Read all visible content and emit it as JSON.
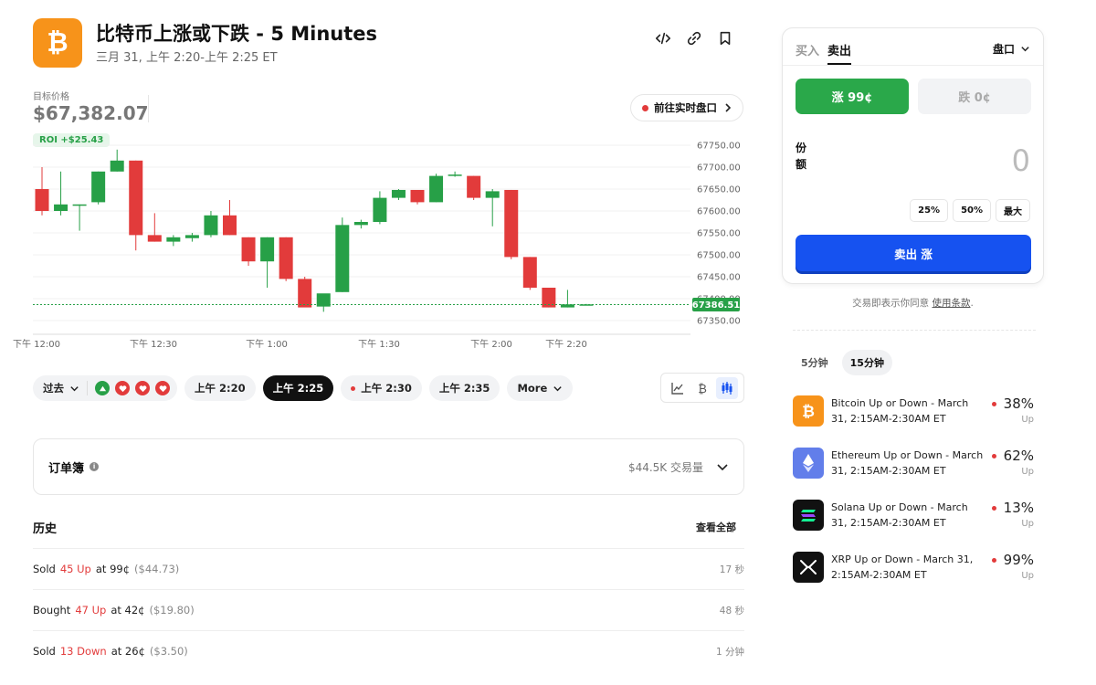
{
  "header": {
    "title": "比特币上涨或下跌 - 5 Minutes",
    "subtitle": "三月 31, 上午 2:20-上午 2:25 ET",
    "icons": [
      "embed-icon",
      "link-icon",
      "bookmark-icon"
    ]
  },
  "price": {
    "target_label": "目标价格",
    "target_value": "$67,382.07",
    "roi": "ROI +$25.43",
    "live_button": "前往实时盘口"
  },
  "chart_data": {
    "type": "candlestick",
    "y_ticks": [
      "67750.00",
      "67700.00",
      "67650.00",
      "67600.00",
      "67550.00",
      "67500.00",
      "67450.00",
      "67400.00",
      "67350.00"
    ],
    "x_ticks": [
      "下午 12:00",
      "下午 12:30",
      "下午 1:00",
      "下午 1:30",
      "下午 2:00",
      "下午 2:20"
    ],
    "ylim": [
      67350,
      67750
    ],
    "current_price": "67386.51",
    "current_price_value": 67386.51,
    "up_color": "#27a047",
    "down_color": "#e23b3b",
    "candles": [
      {
        "o": 67650,
        "h": 67700,
        "l": 67590,
        "c": 67600
      },
      {
        "o": 67600,
        "h": 67690,
        "l": 67590,
        "c": 67615
      },
      {
        "o": 67615,
        "h": 67615,
        "l": 67555,
        "c": 67615
      },
      {
        "o": 67620,
        "h": 67690,
        "l": 67615,
        "c": 67690
      },
      {
        "o": 67690,
        "h": 67740,
        "l": 67690,
        "c": 67715
      },
      {
        "o": 67715,
        "h": 67715,
        "l": 67510,
        "c": 67545
      },
      {
        "o": 67545,
        "h": 67595,
        "l": 67530,
        "c": 67530
      },
      {
        "o": 67530,
        "h": 67545,
        "l": 67520,
        "c": 67540
      },
      {
        "o": 67538,
        "h": 67550,
        "l": 67530,
        "c": 67545
      },
      {
        "o": 67545,
        "h": 67600,
        "l": 67540,
        "c": 67590
      },
      {
        "o": 67590,
        "h": 67625,
        "l": 67545,
        "c": 67545
      },
      {
        "o": 67540,
        "h": 67540,
        "l": 67475,
        "c": 67485
      },
      {
        "o": 67485,
        "h": 67540,
        "l": 67425,
        "c": 67540
      },
      {
        "o": 67540,
        "h": 67540,
        "l": 67440,
        "c": 67445
      },
      {
        "o": 67445,
        "h": 67450,
        "l": 67385,
        "c": 67380
      },
      {
        "o": 67382,
        "h": 67410,
        "l": 67370,
        "c": 67412
      },
      {
        "o": 67415,
        "h": 67585,
        "l": 67415,
        "c": 67568
      },
      {
        "o": 67568,
        "h": 67580,
        "l": 67560,
        "c": 67575
      },
      {
        "o": 67575,
        "h": 67645,
        "l": 67570,
        "c": 67630
      },
      {
        "o": 67630,
        "h": 67650,
        "l": 67625,
        "c": 67648
      },
      {
        "o": 67648,
        "h": 67648,
        "l": 67615,
        "c": 67620
      },
      {
        "o": 67620,
        "h": 67685,
        "l": 67620,
        "c": 67680
      },
      {
        "o": 67680,
        "h": 67690,
        "l": 67678,
        "c": 67683
      },
      {
        "o": 67680,
        "h": 67680,
        "l": 67625,
        "c": 67630
      },
      {
        "o": 67630,
        "h": 67650,
        "l": 67565,
        "c": 67645
      },
      {
        "o": 67648,
        "h": 67648,
        "l": 67490,
        "c": 67495
      },
      {
        "o": 67495,
        "h": 67495,
        "l": 67420,
        "c": 67425
      },
      {
        "o": 67425,
        "h": 67425,
        "l": 67380,
        "c": 67380
      },
      {
        "o": 67380,
        "h": 67420,
        "l": 67380,
        "c": 67387
      },
      {
        "o": 67386,
        "h": 67388,
        "l": 67385,
        "c": 67387
      }
    ]
  },
  "timebar": {
    "past_label": "过去",
    "results": [
      "up",
      "down",
      "down",
      "down"
    ],
    "times": [
      {
        "label": "上午 2:20",
        "active": false,
        "live": false
      },
      {
        "label": "上午 2:25",
        "active": true,
        "live": false
      },
      {
        "label": "上午 2:30",
        "active": false,
        "live": true
      },
      {
        "label": "上午 2:35",
        "active": false,
        "live": false
      }
    ],
    "more_label": "More",
    "chart_types": [
      "line-chart-icon",
      "bitcoin-icon",
      "candlestick-icon"
    ]
  },
  "orderbook": {
    "title": "订单簿",
    "volume": "$44.5K 交易量"
  },
  "history": {
    "title": "历史",
    "view_all": "查看全部",
    "rows": [
      {
        "action": "Sold",
        "qty": "45 Up",
        "at": "at 99¢",
        "total": "($44.73)",
        "ago": "17 秒"
      },
      {
        "action": "Bought",
        "qty": "47 Up",
        "at": "at 42¢",
        "total": "($19.80)",
        "ago": "48 秒"
      },
      {
        "action": "Sold",
        "qty": "13 Down",
        "at": "at 26¢",
        "total": "($3.50)",
        "ago": "1 分钟"
      }
    ]
  },
  "trade": {
    "tab_buy": "买入",
    "tab_sell": "卖出",
    "market_label": "盘口",
    "up_button": "涨 99¢",
    "down_button": "跌 0¢",
    "shares_label": "份额",
    "shares_value": "0",
    "pct_buttons": [
      "25%",
      "50%",
      "最大"
    ],
    "sell_button": "卖出 涨",
    "terms_text": "交易即表示你同意",
    "terms_link": "使用条款",
    "terms_end": "."
  },
  "related": {
    "tabs": [
      {
        "label": "5分钟",
        "active": false
      },
      {
        "label": "15分钟",
        "active": true
      }
    ],
    "markets": [
      {
        "name": "Bitcoin Up or Down - March 31, 2:15AM-2:30AM ET",
        "pct": "38%",
        "dir": "Up",
        "icon": "bitcoin-icon",
        "color": "#f7931a"
      },
      {
        "name": "Ethereum Up or Down - March 31, 2:15AM-2:30AM ET",
        "pct": "62%",
        "dir": "Up",
        "icon": "ethereum-icon",
        "color": "#627eea"
      },
      {
        "name": "Solana Up or Down - March 31, 2:15AM-2:30AM ET",
        "pct": "13%",
        "dir": "Up",
        "icon": "solana-icon",
        "color": "#111111"
      },
      {
        "name": "XRP Up or Down - March 31, 2:15AM-2:30AM ET",
        "pct": "99%",
        "dir": "Up",
        "icon": "xrp-icon",
        "color": "#111111"
      }
    ]
  }
}
